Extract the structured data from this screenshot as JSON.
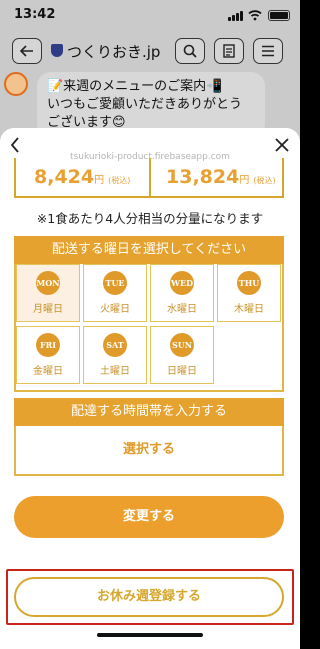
{
  "status_bar": {
    "time": "13:42"
  },
  "browser_nav": {
    "site_title": "つくりおき.jp"
  },
  "chat": {
    "message_lines": [
      "📝来週のメニューのご案内📲",
      "いつもご愛顧いただきありがとう",
      "ございます😊"
    ]
  },
  "sheet": {
    "url": "tsukurioki-product.firebaseapp.com",
    "prices": [
      {
        "amount": "8,424",
        "unit": "円",
        "tax_note": "(税込)"
      },
      {
        "amount": "13,824",
        "unit": "円",
        "tax_note": "(税込)"
      }
    ],
    "portion_note": "※1食あたり4人分相当の分量になります",
    "day_section_title": "配送する曜日を選択してください",
    "days": [
      {
        "abbr": "MON",
        "label": "月曜日",
        "selected": true
      },
      {
        "abbr": "TUE",
        "label": "火曜日",
        "selected": false
      },
      {
        "abbr": "WED",
        "label": "水曜日",
        "selected": false
      },
      {
        "abbr": "THU",
        "label": "木曜日",
        "selected": false
      },
      {
        "abbr": "FRI",
        "label": "金曜日",
        "selected": false
      },
      {
        "abbr": "SAT",
        "label": "土曜日",
        "selected": false
      },
      {
        "abbr": "SUN",
        "label": "日曜日",
        "selected": false
      }
    ],
    "time_section_title": "配達する時間帯を入力する",
    "time_select_label": "選択する",
    "change_button_label": "変更する",
    "holiday_button_label": "お休み週登録する"
  },
  "colors": {
    "accent": "#e6a22f",
    "highlight_border": "#c8241c"
  }
}
